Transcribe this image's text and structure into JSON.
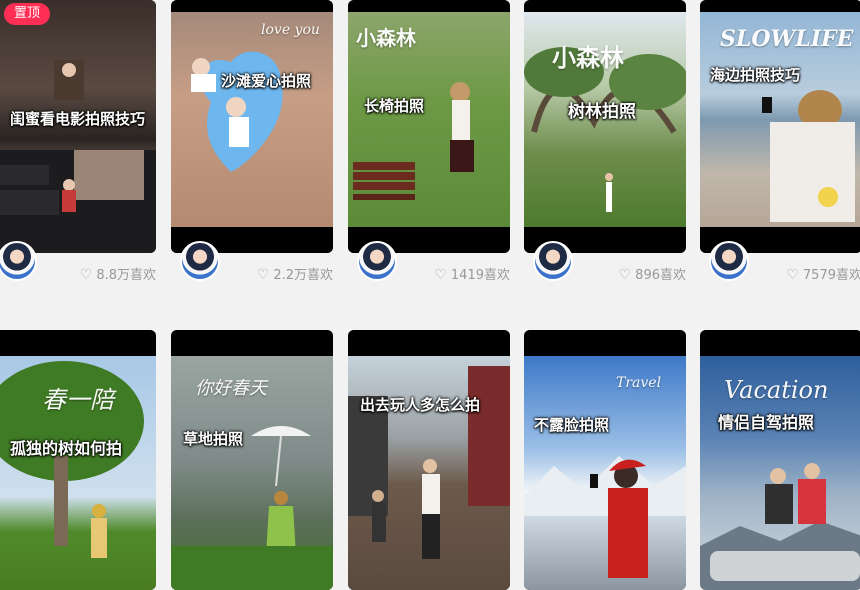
{
  "pin_badge": "置顶",
  "cards": [
    {
      "caption": "闺蜜看电影拍照技巧",
      "likes": "8.8万喜欢"
    },
    {
      "caption": "沙滩爱心拍照",
      "overlay": "love you",
      "likes": "2.2万喜欢"
    },
    {
      "caption": "长椅拍照",
      "overlay": "小森林",
      "likes": "1419喜欢"
    },
    {
      "caption": "树林拍照",
      "overlay": "小森林",
      "likes": "896喜欢"
    },
    {
      "caption": "海边拍照技巧",
      "overlay": "SLOWLIFE",
      "likes": "7579喜欢"
    },
    {
      "caption": "孤独的树如何拍",
      "overlay": "春一陪"
    },
    {
      "caption": "草地拍照",
      "overlay": "你好春天"
    },
    {
      "caption": "出去玩人多怎么拍"
    },
    {
      "caption": "不露脸拍照",
      "overlay": "Travel"
    },
    {
      "caption": "情侣自驾拍照",
      "overlay": "Vacation"
    }
  ],
  "icons": {
    "like": "heart-icon",
    "avatar": "user-avatar"
  }
}
